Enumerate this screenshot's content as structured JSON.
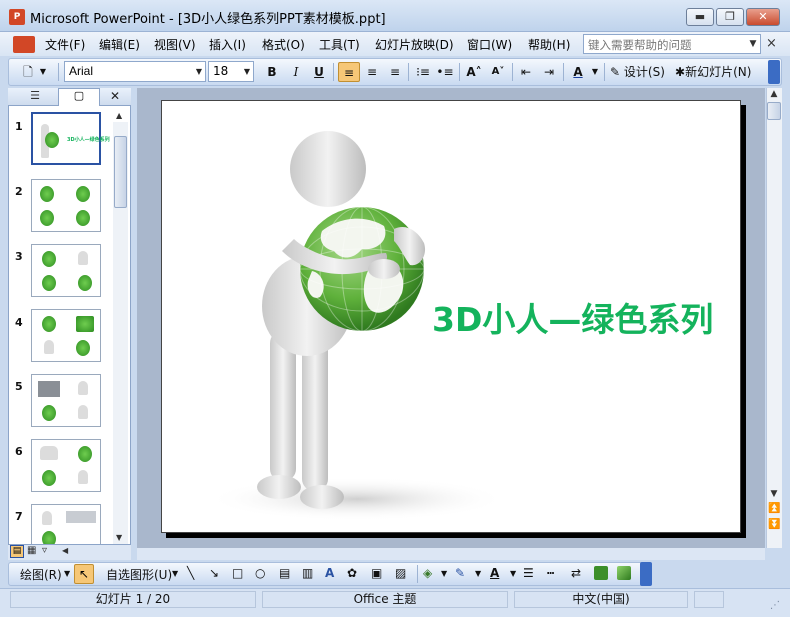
{
  "window": {
    "title": "Microsoft PowerPoint - [3D小人绿色系列PPT素材模板.ppt]",
    "app_icon": "P",
    "controls": {
      "minimize": "▬",
      "restore": "❐",
      "close": "✕"
    }
  },
  "menubar": {
    "items": [
      {
        "label": "文件(F)"
      },
      {
        "label": "编辑(E)"
      },
      {
        "label": "视图(V)"
      },
      {
        "label": "插入(I)"
      },
      {
        "label": "格式(O)"
      },
      {
        "label": "工具(T)"
      },
      {
        "label": "幻灯片放映(D)"
      },
      {
        "label": "窗口(W)"
      },
      {
        "label": "帮助(H)"
      }
    ],
    "help_placeholder": "键入需要帮助的问题",
    "close_glyph": "×"
  },
  "toolbar": {
    "font": "Arial",
    "size": "18",
    "bold": "B",
    "italic": "I",
    "underline": "U",
    "grow_font": "A˄",
    "shrink_font": "A˅",
    "font_color": "A",
    "design_label": "设计(S)",
    "new_slide_label": "新幻灯片(N)"
  },
  "slides_pane": {
    "numbers": [
      "1",
      "2",
      "3",
      "4",
      "5",
      "6",
      "7"
    ],
    "thumb1_caption": "3D小人—绿色系列",
    "close_glyph": "✕"
  },
  "slide": {
    "title": "3D小人—绿色系列"
  },
  "drawbar": {
    "draw_label": "绘图(R)",
    "autoshapes_label": "自选图形(U)"
  },
  "statusbar": {
    "slide_pos": "幻灯片 1 / 20",
    "theme": "Office 主题",
    "language": "中文(中国)"
  },
  "colors": {
    "title_green": "#14b35c",
    "globe_green": "#5fb13b",
    "chrome_blue": "#c9d9ee"
  }
}
